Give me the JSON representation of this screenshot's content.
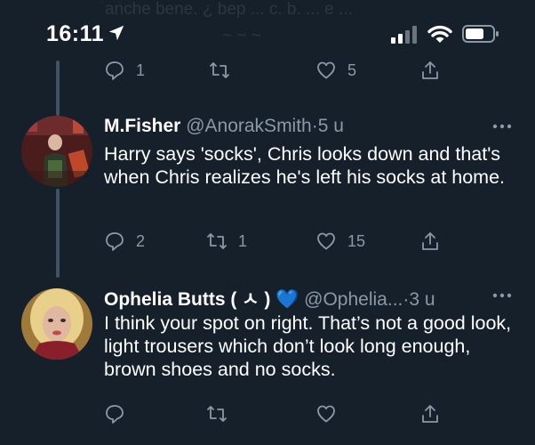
{
  "status_bar": {
    "time": "16:11",
    "ghost_line_1": "anche bene. ¿ bep ... c. b. ... e ...",
    "ghost_line_2": "~ ~ ~"
  },
  "top_actions": {
    "reply_count": "1",
    "retweet_count": "",
    "like_count": "5"
  },
  "tweets": [
    {
      "display_name": "M.Fisher",
      "handle": "@AnorakSmith",
      "separator": "·",
      "time_ago": "5 u",
      "text": "Harry says 'socks', Chris looks down and that's when Chris realizes he's left his socks at home.",
      "reply_count": "2",
      "retweet_count": "1",
      "like_count": "15"
    },
    {
      "display_name": "Ophelia Butts ( ㅅ ) 💙",
      "handle": "@Ophelia...",
      "separator": "·",
      "time_ago": "3 u",
      "text": "I think your spot on right. That’s not a good look, light trousers which don’t look long enough, brown shoes and no socks.",
      "reply_count": "",
      "retweet_count": "",
      "like_count": ""
    }
  ],
  "colors": {
    "background": "#15202b",
    "muted": "#8b98a5",
    "thread_line": "#3d5466"
  }
}
